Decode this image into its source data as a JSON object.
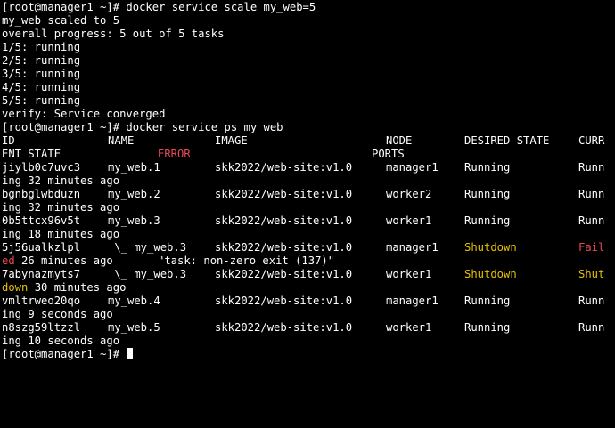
{
  "theme": {
    "background": "#000000",
    "foreground": "#ffffff",
    "red": "#e74856",
    "yellow": "#e5c100"
  },
  "terminal": {
    "block1": {
      "prompt": "[root@manager1 ~]# ",
      "command": "docker service scale my_web=5",
      "output": [
        "my_web scaled to 5",
        "overall progress: 5 out of 5 tasks",
        "1/5: running",
        "2/5: running",
        "3/5: running",
        "4/5: running",
        "5/5: running",
        "verify: Service converged"
      ]
    },
    "block2": {
      "prompt": "[root@manager1 ~]# ",
      "command": "docker service ps my_web",
      "headers": {
        "id": "ID",
        "name": "NAME",
        "image": "IMAGE",
        "node": "NODE",
        "desired_state": "DESIRED STATE",
        "current_state_part1": "CURR",
        "current_state_part2": "ENT STATE",
        "error": "ERROR",
        "ports": "PORTS"
      },
      "rows": [
        {
          "id": "jiylb0c7uvc3",
          "name": "my_web.1",
          "image": "skk2022/web-site:v1.0",
          "node": "manager1",
          "desired": "Running",
          "current_part1": "Runn",
          "current_part2": "ing 32 minutes ago",
          "error": "",
          "desired_color": "white",
          "current_color": "white"
        },
        {
          "id": "bgnbglwbduzn",
          "name": "my_web.2",
          "image": "skk2022/web-site:v1.0",
          "node": "worker2",
          "desired": "Running",
          "current_part1": "Runn",
          "current_part2": "ing 32 minutes ago",
          "error": "",
          "desired_color": "white",
          "current_color": "white"
        },
        {
          "id": "0b5ttcx96v5t",
          "name": "my_web.3",
          "image": "skk2022/web-site:v1.0",
          "node": "worker1",
          "desired": "Running",
          "current_part1": "Runn",
          "current_part2": "ing 18 minutes ago",
          "error": "",
          "desired_color": "white",
          "current_color": "white"
        },
        {
          "id": "5j56ualkzlpl",
          "name": " \\_ my_web.3",
          "image": "skk2022/web-site:v1.0",
          "node": "manager1",
          "desired": "Shutdown",
          "current_part1": "Fail",
          "current_part2": "ed",
          "current_part2_rest": " 26 minutes ago",
          "error": "\"task: non-zero exit (137)\"",
          "desired_color": "yellow",
          "current_color": "red"
        },
        {
          "id": "7abynazmyts7",
          "name": " \\_ my_web.3",
          "image": "skk2022/web-site:v1.0",
          "node": "worker1",
          "desired": "Shutdown",
          "current_part1": "Shut",
          "current_part2": "down",
          "current_part2_rest": " 30 minutes ago",
          "error": "",
          "desired_color": "yellow",
          "current_color": "yellow"
        },
        {
          "id": "vmltrweo20qo",
          "name": "my_web.4",
          "image": "skk2022/web-site:v1.0",
          "node": "manager1",
          "desired": "Running",
          "current_part1": "Runn",
          "current_part2": "ing 9 seconds ago",
          "error": "",
          "desired_color": "white",
          "current_color": "white"
        },
        {
          "id": "n8szg59ltzzl",
          "name": "my_web.5",
          "image": "skk2022/web-site:v1.0",
          "node": "worker1",
          "desired": "Running",
          "current_part1": "Runn",
          "current_part2": "ing 10 seconds ago",
          "error": "",
          "desired_color": "white",
          "current_color": "white"
        }
      ]
    },
    "final_prompt": "[root@manager1 ~]# "
  }
}
